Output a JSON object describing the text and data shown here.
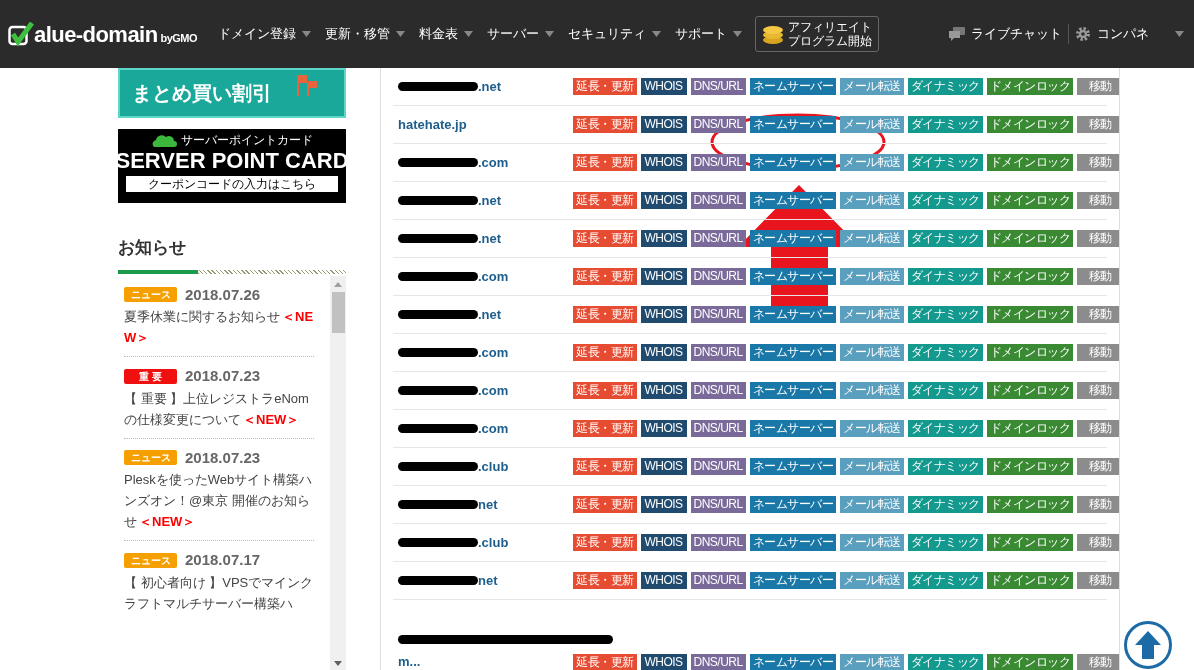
{
  "header": {
    "logo": {
      "text": "alue-domain",
      "by": "byGMO"
    },
    "nav": [
      {
        "label": "ドメイン登録"
      },
      {
        "label": "更新・移管"
      },
      {
        "label": "料金表"
      },
      {
        "label": "サーバー"
      },
      {
        "label": "セキュリティ"
      },
      {
        "label": "サポート"
      }
    ],
    "affiliate": {
      "lines": [
        "アフィリエイト",
        "プログラム開始"
      ]
    },
    "chat": "ライブチャット",
    "panel": "コンパネ"
  },
  "sidebar": {
    "banner_discount": "まとめ買い割引",
    "banner_card": {
      "subtitle": "サーバーポイントカード",
      "title": "SERVER POINT CARD",
      "link": "クーポンコードの入力はこちら"
    },
    "news": {
      "title": "お知らせ",
      "items": [
        {
          "kind": "news",
          "badge": "ニュース",
          "date": "2018.07.26",
          "title": "夏季休業に関するお知らせ",
          "new": "＜NEW＞"
        },
        {
          "kind": "important",
          "badge": "重 要",
          "date": "2018.07.23",
          "title": "【 重要 】上位レジストラeNomの仕様変更について",
          "new": "＜NEW＞"
        },
        {
          "kind": "news",
          "badge": "ニュース",
          "date": "2018.07.23",
          "title": "Pleskを使ったWebサイト構築ハンズオン！@東京 開催のお知らせ",
          "new": "＜NEW＞"
        },
        {
          "kind": "news",
          "badge": "ニュース",
          "date": "2018.07.17",
          "title": "【 初心者向け 】VPSでマインクラフトマルチサーバー構築ハ"
        }
      ]
    }
  },
  "domains": [
    {
      "domain": ".net",
      "redacted": true,
      "actions": [
        "延長・更新",
        "WHOIS",
        "DNS/URL",
        "ネームサーバー",
        "メール転送",
        "ダイナミック",
        "ドメインロック",
        "移動"
      ]
    },
    {
      "domain": "hatehate.jp",
      "redacted": false,
      "actions": [
        "延長・更新",
        "WHOIS",
        "DNS/URL",
        "ネームサーバー",
        "メール転送",
        "ダイナミック",
        "ドメインロック",
        "移動"
      ]
    },
    {
      "domain": ".com",
      "redacted": true,
      "actions": [
        "延長・更新",
        "WHOIS",
        "DNS/URL",
        "ネームサーバー",
        "メール転送",
        "ダイナミック",
        "ドメインロック",
        "移動"
      ]
    },
    {
      "domain": ".net",
      "redacted": true,
      "actions": [
        "延長・更新",
        "WHOIS",
        "DNS/URL",
        "ネームサーバー",
        "メール転送",
        "ダイナミック",
        "ドメインロック",
        "移動"
      ]
    },
    {
      "domain": ".net",
      "redacted": true,
      "actions": [
        "延長・更新",
        "WHOIS",
        "DNS/URL",
        "ネームサーバー",
        "メール転送",
        "ダイナミック",
        "ドメインロック",
        "移動"
      ]
    },
    {
      "domain": ".com",
      "redacted": true,
      "actions": [
        "延長・更新",
        "WHOIS",
        "DNS/URL",
        "ネームサーバー",
        "メール転送",
        "ダイナミック",
        "ドメインロック",
        "移動"
      ]
    },
    {
      "domain": ".net",
      "redacted": true,
      "actions": [
        "延長・更新",
        "WHOIS",
        "DNS/URL",
        "ネームサーバー",
        "メール転送",
        "ダイナミック",
        "ドメインロック",
        "移動"
      ]
    },
    {
      "domain": ".com",
      "redacted": true,
      "actions": [
        "延長・更新",
        "WHOIS",
        "DNS/URL",
        "ネームサーバー",
        "メール転送",
        "ダイナミック",
        "ドメインロック",
        "移動"
      ]
    },
    {
      "domain": ".com",
      "redacted": true,
      "actions": [
        "延長・更新",
        "WHOIS",
        "DNS/URL",
        "ネームサーバー",
        "メール転送",
        "ダイナミック",
        "ドメインロック",
        "移動"
      ]
    },
    {
      "domain": ".com",
      "redacted": true,
      "actions": [
        "延長・更新",
        "WHOIS",
        "DNS/URL",
        "ネームサーバー",
        "メール転送",
        "ダイナミック",
        "ドメインロック",
        "移動"
      ]
    },
    {
      "domain": ".club",
      "redacted": true,
      "actions": [
        "延長・更新",
        "WHOIS",
        "DNS/URL",
        "ネームサーバー",
        "メール転送",
        "ダイナミック",
        "ドメインロック",
        "移動"
      ]
    },
    {
      "domain": "net",
      "redacted": true,
      "actions": [
        "延長・更新",
        "WHOIS",
        "DNS/URL",
        "ネームサーバー",
        "メール転送",
        "ダイナミック",
        "ドメインロック",
        "移動"
      ]
    },
    {
      "domain": ".club",
      "redacted": true,
      "actions": [
        "延長・更新",
        "WHOIS",
        "DNS/URL",
        "ネームサーバー",
        "メール転送",
        "ダイナミック",
        "ドメインロック",
        "移動"
      ]
    },
    {
      "domain": "net",
      "redacted": true,
      "actions": [
        "延長・更新",
        "WHOIS",
        "DNS/URL",
        "ネームサーバー",
        "メール転送",
        "ダイナミック",
        "ドメインロック",
        "移動"
      ]
    },
    {
      "domain": "m...",
      "redacted": true,
      "wrapped": true,
      "actions": [
        "延長・更新",
        "WHOIS",
        "DNS/URL",
        "ネームサーバー",
        "メール転送",
        "ダイナミック",
        "ドメインロック",
        "移動"
      ]
    }
  ]
}
